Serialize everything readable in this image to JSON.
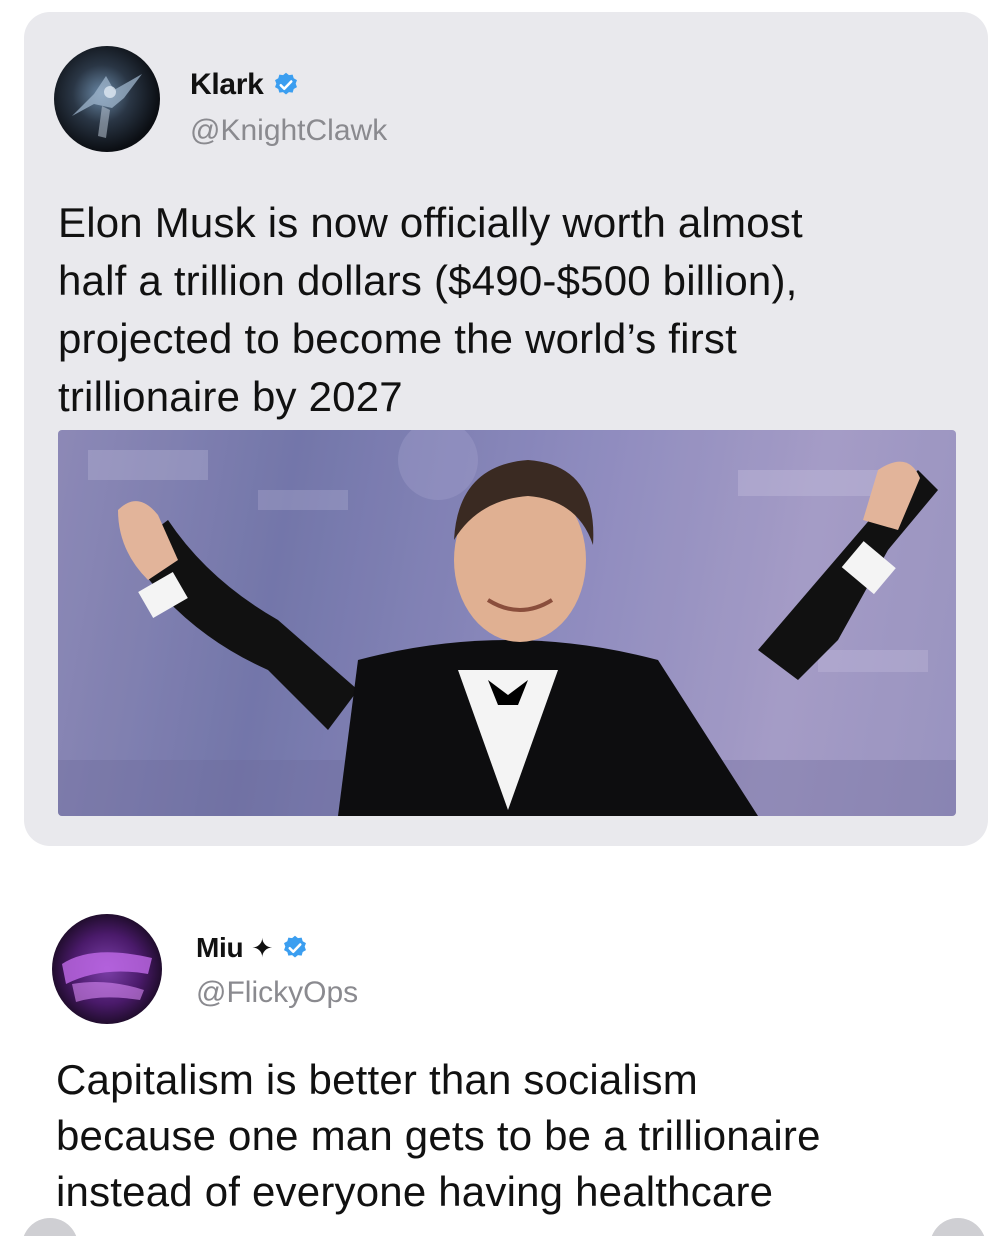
{
  "quoted_tweet": {
    "display_name": "Klark",
    "handle": "@KnightClawk",
    "text_lines": [
      "Elon Musk is now officially worth almost",
      "half a trillion dollars ($490-$500 billion),",
      "projected to become the world’s first",
      "trillionaire by 2027"
    ],
    "verified_icon": "verified-badge-icon",
    "verified_color": "#3b9ef0"
  },
  "reply_tweet": {
    "display_name": "Miu",
    "name_glyph": "✦",
    "handle": "@FlickyOps",
    "text_lines": [
      "Capitalism is better than socialism",
      "because one man gets to be a trillionaire",
      "instead of everyone having healthcare"
    ],
    "verified_icon": "verified-badge-icon",
    "verified_color": "#3b9ef0"
  }
}
